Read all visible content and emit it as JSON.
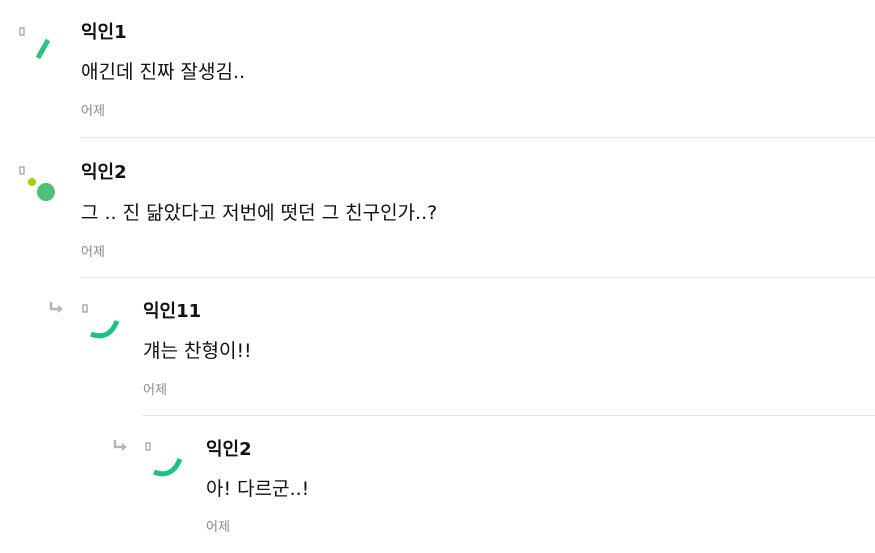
{
  "comments": [
    {
      "author": "익인1",
      "text": "애긴데 진짜 잘생김..",
      "time": "어제",
      "avatar_icon": "green-stroke-avatar-icon",
      "avatar_color": "#2ec27e"
    },
    {
      "author": "익인2",
      "text": "그 .. 진 닮았다고 저번에 떳던 그 친구인가..?",
      "time": "어제",
      "avatar_icon": "green-dots-avatar-icon",
      "avatar_color": "#4fbf7a",
      "avatar_accent": "#9bd400"
    },
    {
      "author": "익인11",
      "text": "걔는 찬형이!!",
      "time": "어제",
      "avatar_icon": "green-arc-avatar-icon",
      "avatar_color": "#1fbf8a",
      "is_reply": true
    },
    {
      "author": "익인2",
      "text": "아! 다르군..!",
      "time": "어제",
      "avatar_icon": "green-arc-avatar-icon",
      "avatar_color": "#1fbf8a",
      "is_reply": true
    }
  ],
  "icons": {
    "reply_arrow": "reply-arrow-icon",
    "arrow_color": "#b5b5b5"
  }
}
